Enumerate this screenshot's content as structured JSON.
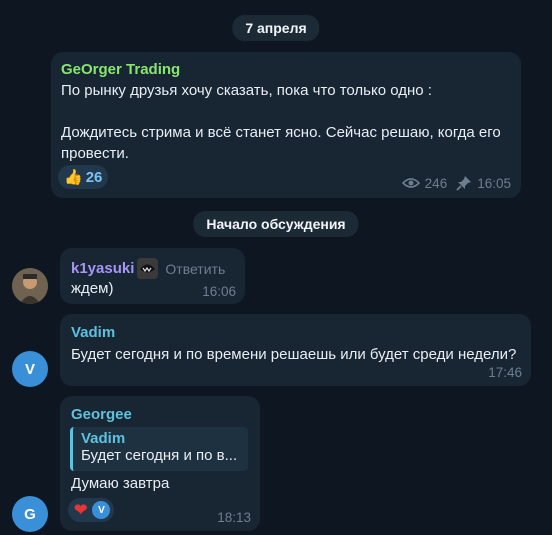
{
  "date_pill": "7 апреля",
  "post": {
    "author": "GeOrger Trading",
    "line1": "По рынку друзья хочу сказать, пока что только одно :",
    "line2": "Дождитесь стрима и всё станет ясно. Сейчас решаю, когда его",
    "line3": "провести.",
    "reaction_emoji": "👍",
    "reaction_count": "26",
    "views": "246",
    "time": "16:05"
  },
  "discussion_pill": "Начало обсуждения",
  "comments": [
    {
      "author": "k1yasuki",
      "reply_label": "Ответить",
      "text": "ждем)",
      "time": "16:06"
    },
    {
      "author": "Vadim",
      "avatar_letter": "V",
      "text": "Будет сегодня и по времени решаешь или будет среди недели?",
      "time": "17:46"
    },
    {
      "author": "Georgee",
      "avatar_letter": "G",
      "quote_author": "Vadim",
      "quote_text": "Будет сегодня и по в...",
      "text": "Думаю завтра",
      "reaction_emoji": "❤",
      "reactor_letter": "V",
      "time": "18:13"
    }
  ],
  "colors": {
    "accent": "#5ec1dd",
    "post_author": "#86e86b",
    "k1yasuki": "#a695f4",
    "heart": "#e53535"
  },
  "icons": {
    "views": "eye-icon",
    "pin": "pin-icon"
  }
}
